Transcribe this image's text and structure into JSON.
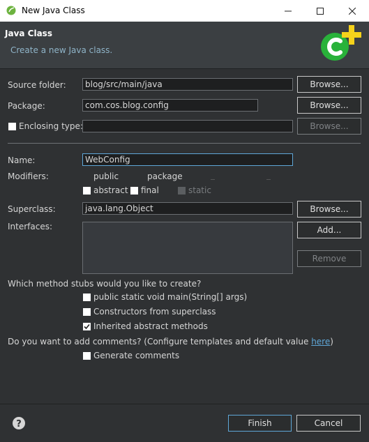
{
  "window": {
    "title": "New Java Class",
    "controls": {
      "minimize": "minimize-icon",
      "maximize": "maximize-icon",
      "close": "close-icon"
    }
  },
  "header": {
    "title": "Java Class",
    "subtitle": "Create a new Java class."
  },
  "form": {
    "source_folder": {
      "label": "Source folder:",
      "value": "blog/src/main/java",
      "button": "Browse..."
    },
    "package": {
      "label": "Package:",
      "value": "com.cos.blog.config",
      "button": "Browse..."
    },
    "enclosing_type": {
      "label": "Enclosing type:",
      "value": "",
      "button": "Browse...",
      "checked": false
    },
    "name": {
      "label": "Name:",
      "value": "WebConfig"
    },
    "modifiers": {
      "label": "Modifiers:",
      "access": [
        "public",
        "package",
        "",
        ""
      ],
      "abstract": "abstract",
      "final": "final",
      "static": "static"
    },
    "superclass": {
      "label": "Superclass:",
      "value": "java.lang.Object",
      "button": "Browse..."
    },
    "interfaces": {
      "label": "Interfaces:",
      "add_button": "Add...",
      "remove_button": "Remove"
    }
  },
  "stubs": {
    "question": "Which method stubs would you like to create?",
    "main": {
      "label": "public static void main(String[] args)",
      "checked": false
    },
    "constructors": {
      "label": "Constructors from superclass",
      "checked": false
    },
    "inherited": {
      "label": "Inherited abstract methods",
      "checked": true
    }
  },
  "comments": {
    "question_prefix": "Do you want to add comments? (Configure templates and default value ",
    "link": "here",
    "question_suffix": ")",
    "generate": {
      "label": "Generate comments",
      "checked": false
    }
  },
  "footer": {
    "finish": "Finish",
    "cancel": "Cancel",
    "help_icon": "help-icon"
  },
  "colors": {
    "accent": "#5fa7d8",
    "link": "#5fa7d8",
    "logo_green": "#29b23a",
    "logo_yellow": "#f5d21b"
  }
}
